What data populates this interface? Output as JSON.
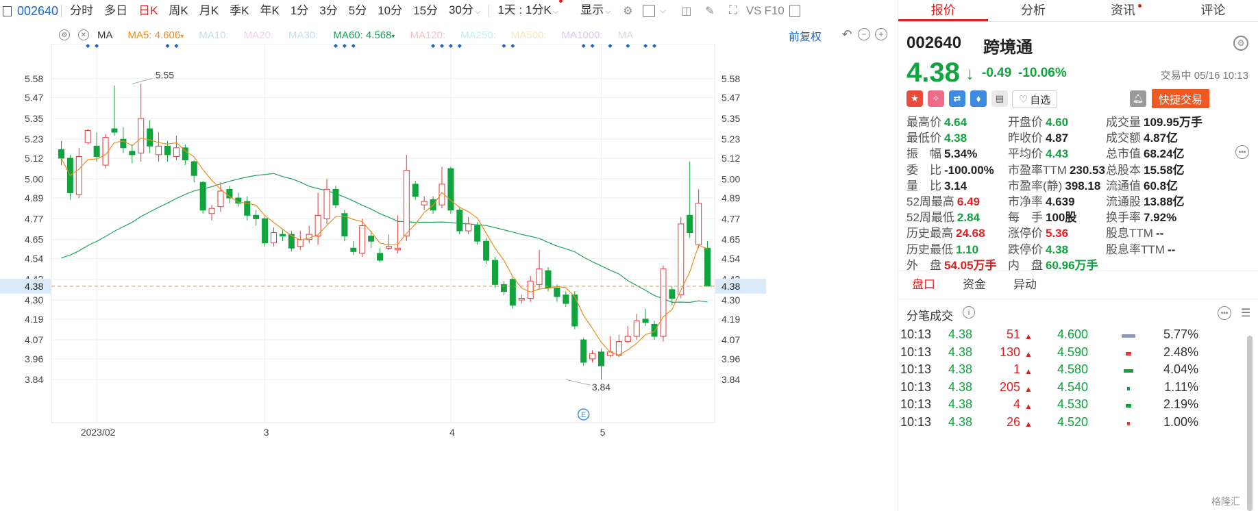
{
  "toolbar": {
    "code": "002640",
    "periods": [
      "分时",
      "多日",
      "日K",
      "周K",
      "月K",
      "季K",
      "年K",
      "1分",
      "3分",
      "5分",
      "10分",
      "15分",
      "30分"
    ],
    "active_period": "日K",
    "interval_label": "1天 : 1分K",
    "display_label": "显示",
    "vs_label": "VS",
    "f10_label": "F10"
  },
  "ma_row": {
    "ma_label": "MA",
    "ma5_label": "MA5:",
    "ma5_value": "4.606",
    "ma10_label": "MA10:",
    "ma20_label": "MA20:",
    "ma30_label": "MA30:",
    "ma60_label": "MA60:",
    "ma60_value": "4.568",
    "ma120_label": "MA120:",
    "ma250_label": "MA250:",
    "ma500_label": "MA500:",
    "ma1000_label": "MA1000:",
    "ma_cut_label": "MA",
    "fuquan_label": "前复权",
    "colors": {
      "ma5": "#f08c1a",
      "ma10": "#4a9fe0",
      "ma20": "#e37cc4",
      "ma30": "#52a7e0",
      "ma60": "#1ba35a",
      "ma120": "#e0495e",
      "ma250": "#4ad0e0",
      "ma500": "#f0b84a",
      "ma1000": "#9a5ee0"
    }
  },
  "chart_data": {
    "type": "candlestick",
    "y_ticks": [
      "5.58",
      "5.47",
      "5.35",
      "5.23",
      "5.12",
      "5.00",
      "4.89",
      "4.77",
      "4.65",
      "4.54",
      "4.42",
      "4.30",
      "4.19",
      "4.07",
      "3.96",
      "3.84"
    ],
    "ylim": [
      3.72,
      5.7
    ],
    "x_labels": [
      "2023/02",
      "3",
      "4",
      "5"
    ],
    "x_label_index": [
      4,
      23,
      44,
      61
    ],
    "current_price_label": "4.38",
    "current_price": 4.38,
    "high_annotation": "5.55",
    "high_index": 8,
    "high_value": 5.55,
    "low_annotation": "3.84",
    "low_index": 57,
    "low_value": 3.84,
    "event_label": "E",
    "up_color": "#e03a3a",
    "down_color": "#11a33e",
    "dot_color": "#1a66c9",
    "marker_slots": [
      3,
      4,
      12,
      13,
      31,
      32,
      33,
      42,
      43,
      44,
      45,
      50,
      51,
      59,
      60,
      62,
      64,
      66,
      67
    ],
    "candles": [
      {
        "o": 5.17,
        "c": 5.12,
        "h": 5.22,
        "l": 5.08
      },
      {
        "o": 5.12,
        "c": 4.92,
        "h": 5.14,
        "l": 4.88
      },
      {
        "o": 4.91,
        "c": 5.13,
        "h": 5.18,
        "l": 4.89
      },
      {
        "o": 5.21,
        "c": 5.28,
        "h": 5.29,
        "l": 5.2
      },
      {
        "o": 5.19,
        "c": 5.13,
        "h": 5.27,
        "l": 5.1
      },
      {
        "o": 5.08,
        "c": 5.24,
        "h": 5.26,
        "l": 5.06
      },
      {
        "o": 5.29,
        "c": 5.27,
        "h": 5.54,
        "l": 5.25
      },
      {
        "o": 5.23,
        "c": 5.18,
        "h": 5.3,
        "l": 5.15
      },
      {
        "o": 5.16,
        "c": 5.14,
        "h": 5.2,
        "l": 5.09
      },
      {
        "o": 5.15,
        "c": 5.35,
        "h": 5.55,
        "l": 5.1
      },
      {
        "o": 5.29,
        "c": 5.19,
        "h": 5.34,
        "l": 5.15
      },
      {
        "o": 5.14,
        "c": 5.19,
        "h": 5.27,
        "l": 5.1
      },
      {
        "o": 5.19,
        "c": 5.14,
        "h": 5.22,
        "l": 5.1
      },
      {
        "o": 5.13,
        "c": 5.18,
        "h": 5.25,
        "l": 5.11
      },
      {
        "o": 5.18,
        "c": 5.11,
        "h": 5.2,
        "l": 5.08
      },
      {
        "o": 5.1,
        "c": 5.02,
        "h": 5.11,
        "l": 4.98
      },
      {
        "o": 4.98,
        "c": 4.82,
        "h": 4.99,
        "l": 4.8
      },
      {
        "o": 4.8,
        "c": 4.83,
        "h": 4.85,
        "l": 4.76
      },
      {
        "o": 4.84,
        "c": 4.93,
        "h": 4.98,
        "l": 4.81
      },
      {
        "o": 4.94,
        "c": 4.89,
        "h": 4.96,
        "l": 4.86
      },
      {
        "o": 4.89,
        "c": 4.86,
        "h": 4.92,
        "l": 4.84
      },
      {
        "o": 4.87,
        "c": 4.79,
        "h": 4.9,
        "l": 4.76
      },
      {
        "o": 4.79,
        "c": 4.77,
        "h": 4.82,
        "l": 4.73
      },
      {
        "o": 4.77,
        "c": 4.63,
        "h": 4.78,
        "l": 4.61
      },
      {
        "o": 4.63,
        "c": 4.69,
        "h": 4.72,
        "l": 4.61
      },
      {
        "o": 4.68,
        "c": 4.67,
        "h": 4.71,
        "l": 4.64
      },
      {
        "o": 4.68,
        "c": 4.6,
        "h": 4.7,
        "l": 4.58
      },
      {
        "o": 4.61,
        "c": 4.65,
        "h": 4.7,
        "l": 4.59
      },
      {
        "o": 4.65,
        "c": 4.68,
        "h": 4.73,
        "l": 4.63
      },
      {
        "o": 4.67,
        "c": 4.79,
        "h": 4.92,
        "l": 4.62
      },
      {
        "o": 4.77,
        "c": 4.94,
        "h": 5.0,
        "l": 4.74
      },
      {
        "o": 4.94,
        "c": 4.85,
        "h": 4.96,
        "l": 4.83
      },
      {
        "o": 4.8,
        "c": 4.67,
        "h": 4.82,
        "l": 4.64
      },
      {
        "o": 4.6,
        "c": 4.58,
        "h": 4.64,
        "l": 4.56
      },
      {
        "o": 4.57,
        "c": 4.73,
        "h": 4.77,
        "l": 4.55
      },
      {
        "o": 4.67,
        "c": 4.64,
        "h": 4.7,
        "l": 4.6
      },
      {
        "o": 4.57,
        "c": 4.53,
        "h": 4.6,
        "l": 4.52
      },
      {
        "o": 4.6,
        "c": 4.61,
        "h": 4.68,
        "l": 4.59
      },
      {
        "o": 4.59,
        "c": 4.6,
        "h": 4.79,
        "l": 4.57
      },
      {
        "o": 4.67,
        "c": 5.05,
        "h": 5.14,
        "l": 4.64
      },
      {
        "o": 4.97,
        "c": 4.9,
        "h": 4.99,
        "l": 4.88
      },
      {
        "o": 4.85,
        "c": 4.87,
        "h": 4.9,
        "l": 4.82
      },
      {
        "o": 4.88,
        "c": 4.82,
        "h": 4.9,
        "l": 4.8
      },
      {
        "o": 4.85,
        "c": 4.97,
        "h": 5.07,
        "l": 4.83
      },
      {
        "o": 5.06,
        "c": 4.82,
        "h": 5.07,
        "l": 4.8
      },
      {
        "o": 4.82,
        "c": 4.7,
        "h": 4.84,
        "l": 4.68
      },
      {
        "o": 4.7,
        "c": 4.74,
        "h": 4.78,
        "l": 4.68
      },
      {
        "o": 4.73,
        "c": 4.64,
        "h": 4.75,
        "l": 4.62
      },
      {
        "o": 4.64,
        "c": 4.53,
        "h": 4.66,
        "l": 4.51
      },
      {
        "o": 4.53,
        "c": 4.39,
        "h": 4.55,
        "l": 4.37
      },
      {
        "o": 4.39,
        "c": 4.35,
        "h": 4.41,
        "l": 4.33
      },
      {
        "o": 4.42,
        "c": 4.27,
        "h": 4.43,
        "l": 4.25
      },
      {
        "o": 4.3,
        "c": 4.31,
        "h": 4.33,
        "l": 4.28
      },
      {
        "o": 4.31,
        "c": 4.41,
        "h": 4.44,
        "l": 4.29
      },
      {
        "o": 4.39,
        "c": 4.48,
        "h": 4.59,
        "l": 4.36
      },
      {
        "o": 4.47,
        "c": 4.37,
        "h": 4.49,
        "l": 4.35
      },
      {
        "o": 4.37,
        "c": 4.32,
        "h": 4.39,
        "l": 4.29
      },
      {
        "o": 4.33,
        "c": 4.28,
        "h": 4.35,
        "l": 4.26
      },
      {
        "o": 4.33,
        "c": 4.15,
        "h": 4.35,
        "l": 4.13
      },
      {
        "o": 4.07,
        "c": 3.94,
        "h": 4.08,
        "l": 3.92
      },
      {
        "o": 3.96,
        "c": 3.99,
        "h": 4.01,
        "l": 3.94
      },
      {
        "o": 4.0,
        "c": 3.92,
        "h": 4.02,
        "l": 3.84
      },
      {
        "o": 3.98,
        "c": 4.0,
        "h": 4.09,
        "l": 3.97
      },
      {
        "o": 3.98,
        "c": 4.06,
        "h": 4.1,
        "l": 3.97
      },
      {
        "o": 4.06,
        "c": 4.09,
        "h": 4.15,
        "l": 4.05
      },
      {
        "o": 4.09,
        "c": 4.18,
        "h": 4.22,
        "l": 4.07
      },
      {
        "o": 4.19,
        "c": 4.17,
        "h": 4.25,
        "l": 4.15
      },
      {
        "o": 4.16,
        "c": 4.09,
        "h": 4.18,
        "l": 4.07
      },
      {
        "o": 4.09,
        "c": 4.48,
        "h": 4.5,
        "l": 4.06
      },
      {
        "o": 4.36,
        "c": 4.31,
        "h": 4.38,
        "l": 4.27
      },
      {
        "o": 4.33,
        "c": 4.74,
        "h": 4.78,
        "l": 4.31
      },
      {
        "o": 4.79,
        "c": 4.69,
        "h": 5.1,
        "l": 4.66
      },
      {
        "o": 4.62,
        "c": 4.86,
        "h": 4.94,
        "l": 4.6
      },
      {
        "o": 4.6,
        "c": 4.38,
        "h": 4.64,
        "l": 4.38
      }
    ]
  },
  "panel": {
    "tabs": [
      "报价",
      "分析",
      "资讯",
      "评论"
    ],
    "active_tab": "报价",
    "code": "002640",
    "name": "跨境通",
    "price": "4.38",
    "change": "-0.49",
    "change_pct": "-10.06%",
    "status": "交易中 05/16 10:13",
    "icons": [
      "cn-flag-icon",
      "ai-icon",
      "shuffle-icon",
      "tag-icon",
      "book-icon"
    ],
    "zixuan_label": "自选",
    "trade_label": "快捷交易",
    "stats": [
      {
        "label": "最高价",
        "value": "4.64",
        "color": "green"
      },
      {
        "label": "开盘价",
        "value": "4.60",
        "color": "green"
      },
      {
        "label": "成交量",
        "value": "109.95万手",
        "color": "black"
      },
      {
        "label": "最低价",
        "value": "4.38",
        "color": "green"
      },
      {
        "label": "昨收价",
        "value": "4.87",
        "color": "black"
      },
      {
        "label": "成交额",
        "value": "4.87亿",
        "color": "black"
      },
      {
        "label": "振　幅",
        "value": "5.34%",
        "color": "black"
      },
      {
        "label": "平均价",
        "value": "4.43",
        "color": "green"
      },
      {
        "label": "总市值",
        "value": "68.24亿",
        "color": "black"
      },
      {
        "label": "委　比",
        "value": "-100.00%",
        "color": "black"
      },
      {
        "label": "市盈率TTM",
        "value": "230.53",
        "color": "black"
      },
      {
        "label": "总股本",
        "value": "15.58亿",
        "color": "black"
      },
      {
        "label": "量　比",
        "value": "3.14",
        "color": "black"
      },
      {
        "label": "市盈率(静)",
        "value": "398.18",
        "color": "black"
      },
      {
        "label": "流通值",
        "value": "60.8亿",
        "color": "black"
      },
      {
        "label": "52周最高",
        "value": "6.49",
        "color": "red"
      },
      {
        "label": "市净率",
        "value": "4.639",
        "color": "black"
      },
      {
        "label": "流通股",
        "value": "13.88亿",
        "color": "black"
      },
      {
        "label": "52周最低",
        "value": "2.84",
        "color": "green"
      },
      {
        "label": "每　手",
        "value": "100股",
        "color": "black"
      },
      {
        "label": "换手率",
        "value": "7.92%",
        "color": "black"
      },
      {
        "label": "历史最高",
        "value": "24.68",
        "color": "red"
      },
      {
        "label": "涨停价",
        "value": "5.36",
        "color": "red"
      },
      {
        "label": "股息TTM",
        "value": "--",
        "color": "black"
      },
      {
        "label": "历史最低",
        "value": "1.10",
        "color": "green"
      },
      {
        "label": "跌停价",
        "value": "4.38",
        "color": "green"
      },
      {
        "label": "股息率TTM",
        "value": "--",
        "color": "black"
      },
      {
        "label": "外　盘",
        "value": "54.05万手",
        "color": "red"
      },
      {
        "label": "内　盘",
        "value": "60.96万手",
        "color": "green"
      }
    ],
    "subtabs": [
      "盘口",
      "资金",
      "异动"
    ],
    "active_subtab": "盘口",
    "trades_title": "分笔成交",
    "trades": [
      {
        "time": "10:13",
        "price": "4.38",
        "vol": "51",
        "p2": "4.600",
        "pct": "5.77%",
        "pct_value": 0.0577,
        "bar_color": "#8a9bb0"
      },
      {
        "time": "10:13",
        "price": "4.38",
        "vol": "130",
        "p2": "4.590",
        "pct": "2.48%",
        "pct_value": 0.0248,
        "bar_color": "#e03a3a"
      },
      {
        "time": "10:13",
        "price": "4.38",
        "vol": "1",
        "p2": "4.580",
        "pct": "4.04%",
        "pct_value": 0.0404,
        "bar_color": "#11a33e"
      },
      {
        "time": "10:13",
        "price": "4.38",
        "vol": "205",
        "p2": "4.540",
        "pct": "1.11%",
        "pct_value": 0.0111,
        "bar_color": "#11a33e"
      },
      {
        "time": "10:13",
        "price": "4.38",
        "vol": "4",
        "p2": "4.530",
        "pct": "2.19%",
        "pct_value": 0.0219,
        "bar_color": "#11a33e"
      },
      {
        "time": "10:13",
        "price": "4.38",
        "vol": "26",
        "p2": "4.520",
        "pct": "1.00%",
        "pct_value": 0.01,
        "bar_color": "#e03a3a"
      }
    ],
    "watermark": "格隆汇"
  }
}
